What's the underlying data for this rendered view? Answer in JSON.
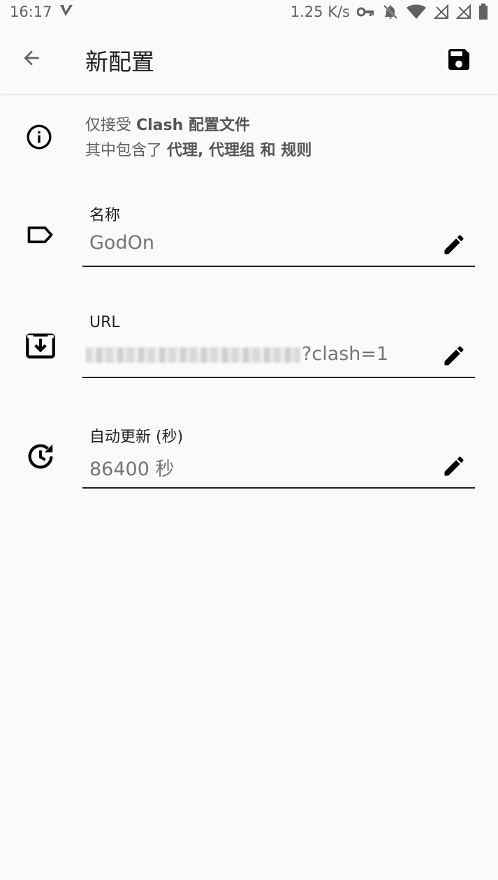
{
  "status_bar": {
    "time": "16:17",
    "speed": "1.25 K/s"
  },
  "app_bar": {
    "title": "新配置",
    "back_icon": "arrow-left-icon",
    "save_icon": "floppy-disk-icon"
  },
  "info": {
    "line1_prefix": "仅接受 ",
    "line1_bold": "Clash 配置文件",
    "line2_prefix": "其中包含了 ",
    "line2_bold": "代理, 代理组 和 规则"
  },
  "fields": {
    "name": {
      "label": "名称",
      "value": "GodOn"
    },
    "url": {
      "label": "URL",
      "value_visible": "clash=1",
      "value_visible_prefix": "?"
    },
    "auto_update": {
      "label": "自动更新 (秒)",
      "value": "86400 秒"
    }
  },
  "colors": {
    "background": "#fafafa",
    "text_primary": "#212121",
    "text_secondary": "#757575",
    "underline": "#212121"
  }
}
